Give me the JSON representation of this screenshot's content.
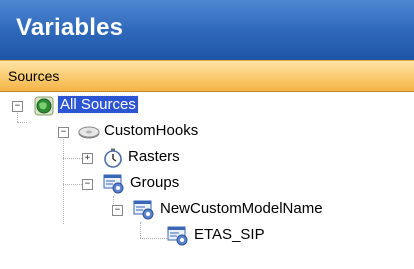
{
  "panel": {
    "title": "Variables"
  },
  "sources_header": {
    "label": "Sources"
  },
  "tree": {
    "all_sources": {
      "label": "All Sources",
      "expander": "−",
      "icon": "globe-icon"
    },
    "custom_hooks": {
      "label": "CustomHooks",
      "expander": "−",
      "icon": "disk-icon"
    },
    "rasters": {
      "label": "Rasters",
      "expander": "+",
      "icon": "stopwatch-icon"
    },
    "groups": {
      "label": "Groups",
      "expander": "−",
      "icon": "group-icon"
    },
    "new_custom_model": {
      "label": "NewCustomModelName",
      "expander": "−",
      "icon": "group-icon"
    },
    "etas_sip": {
      "label": "ETAS_SIP",
      "icon": "group-icon"
    }
  }
}
